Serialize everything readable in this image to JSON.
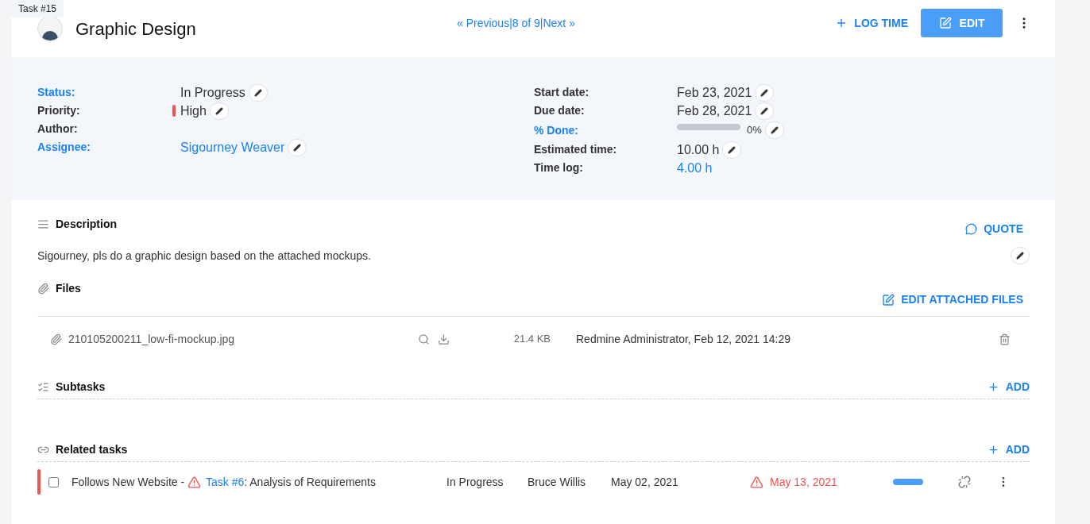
{
  "tag": "Task #15",
  "header": {
    "title": "Graphic Design",
    "nav": {
      "previous": "« Previous",
      "separator_1": "|",
      "position": "8 of 9",
      "separator_2": "|",
      "next": "Next »"
    },
    "log_time": "LOG TIME",
    "edit": "EDIT"
  },
  "fields_left": [
    {
      "label": "Status:",
      "label_link": true,
      "kind": "text",
      "value": "In Progress",
      "editable": true
    },
    {
      "label": "Priority:",
      "label_link": false,
      "kind": "priority",
      "value": "High",
      "color": "#ef5350",
      "editable": true
    },
    {
      "label": "Author:",
      "label_link": false,
      "kind": "empty",
      "editable": false
    },
    {
      "label": "Assignee:",
      "label_link": true,
      "kind": "link",
      "value": "Sigourney Weaver",
      "editable": true
    }
  ],
  "fields_right": [
    {
      "label": "Start date:",
      "label_link": false,
      "kind": "text",
      "value": "Feb 23, 2021",
      "editable": true
    },
    {
      "label": "Due date:",
      "label_link": false,
      "kind": "text",
      "value": "Feb 28, 2021",
      "editable": true
    },
    {
      "label": "% Done:",
      "label_link": true,
      "kind": "progress",
      "level": 0,
      "value": "0%",
      "editable": true
    },
    {
      "label": "Estimated time:",
      "label_link": false,
      "kind": "text",
      "value": "10.00 h",
      "editable": true
    },
    {
      "label": "Time log:",
      "label_link": false,
      "kind": "link",
      "value": "4.00 h",
      "editable": false
    }
  ],
  "description": {
    "title": "Description",
    "quote": "QUOTE",
    "text": "Sigourney, pls do a graphic design based on the attached mockups."
  },
  "files": {
    "title": "Files",
    "edit": "EDIT ATTACHED FILES",
    "items": [
      {
        "name": "210105200211_low-fi-mockup.jpg",
        "size": "21.4 KB",
        "author_date": "Redmine Administrator, Feb 12, 2021 14:29"
      }
    ]
  },
  "subtasks": {
    "title": "Subtasks",
    "add": "ADD"
  },
  "related": {
    "title": "Related tasks",
    "add": "ADD",
    "rows": [
      {
        "color": "#ef5350",
        "checked": false,
        "relation": "Follows New Website - ",
        "warning": true,
        "task_link": "Task #6",
        "subject": ": Analysis of Requirements",
        "status": "In Progress",
        "assignee": "Bruce Willis",
        "start": "May 02, 2021",
        "due": "May 13, 2021",
        "due_overdue": true,
        "level": 1
      }
    ]
  }
}
